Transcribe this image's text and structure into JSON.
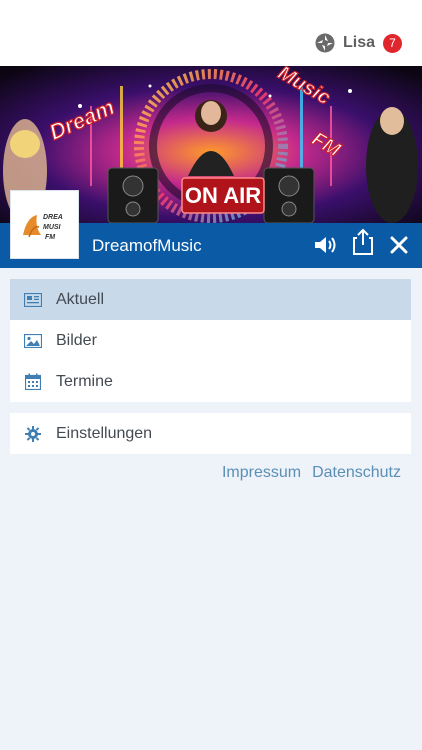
{
  "header": {
    "user_name": "Lisa",
    "notification_count": "7",
    "user_icon": "joomag-swirl-icon"
  },
  "banner": {
    "texts": {
      "dream": "Dream",
      "music": "Music",
      "fm": "FM",
      "on_air": "ON AIR"
    },
    "logo_lines": [
      "DREA",
      "MUSI",
      "FM"
    ]
  },
  "station": {
    "name": "DreamofMusic",
    "bar_color": "#0a5aa6",
    "icons": [
      "volume-icon",
      "share-icon",
      "close-icon"
    ]
  },
  "menu_main": [
    {
      "label": "Aktuell",
      "icon": "newspaper-icon",
      "active": true
    },
    {
      "label": "Bilder",
      "icon": "image-icon",
      "active": false
    },
    {
      "label": "Termine",
      "icon": "calendar-icon",
      "active": false
    }
  ],
  "menu_settings": {
    "label": "Einstellungen",
    "icon": "gear-icon"
  },
  "footer": {
    "impressum": "Impressum",
    "datenschutz": "Datenschutz"
  },
  "colors": {
    "accent_blue": "#0a5aa6",
    "active_row": "#c8d9ea",
    "badge_red": "#e0262d",
    "link_blue": "#5b8fb4",
    "page_bg": "#eef2f9"
  }
}
